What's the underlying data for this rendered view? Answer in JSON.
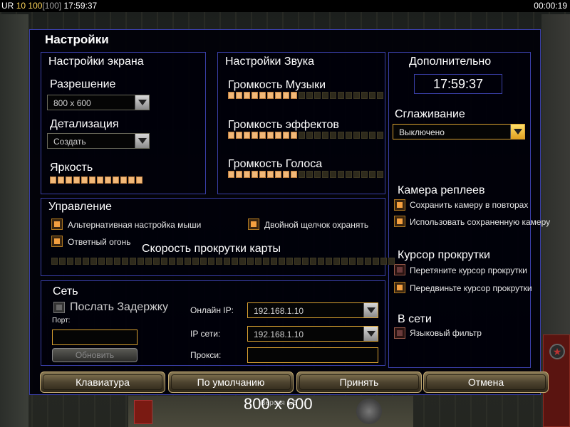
{
  "status_bar": {
    "ur": "UR",
    "level": "10",
    "power": "100",
    "power_max": "[100]",
    "clock": "17:59:37",
    "timer": "00:00:19"
  },
  "dialog": {
    "title": "Настройки",
    "screen": {
      "title": "Настройки экрана",
      "resolution_label": "Разрешение",
      "resolution_value": "800 x 600",
      "detail_label": "Детализация",
      "detail_value": "Создать",
      "brightness_label": "Яркость",
      "brightness_level": 12,
      "brightness_max": 12
    },
    "sound": {
      "title": "Настройки Звука",
      "music_label": "Громкость Музыки",
      "music_level": 9,
      "effects_label": "Громкость эффектов",
      "effects_level": 9,
      "voice_label": "Громкость Голоса",
      "voice_level": 9,
      "segments_max": 20
    },
    "extra": {
      "title": "Дополнительно",
      "clock": "17:59:37",
      "antialias_label": "Сглаживание",
      "antialias_value": "Выключено",
      "replay_camera_label": "Камера реплеев",
      "save_camera": "Сохранить камеру в повторах",
      "use_saved_camera": "Использовать сохраненную камеру",
      "scroll_cursor_label": "Курсор прокрутки",
      "drag_cursor": "Перетяните курсор прокрутки",
      "move_cursor": "Передвиньте курсор прокрутки",
      "online_label": "В сети",
      "language_filter": "Языковый фильтр"
    },
    "control": {
      "title": "Управление",
      "alt_mouse": "Альтернативная настройка мыши",
      "double_click_guard": "Двойной щелчок охранять",
      "return_fire": "Ответный огонь",
      "scroll_speed_label": "Скорость прокрутки карты",
      "scroll_speed_level": 0,
      "scroll_segments_max": 44
    },
    "network": {
      "title": "Сеть",
      "send_delay": "Послать Задержку",
      "port_label": "Порт:",
      "port_value": "",
      "online_ip_label": "Онлайн IP:",
      "online_ip_value": "192.168.1.10",
      "lan_ip_label": "IP сети:",
      "lan_ip_value": "192.168.1.10",
      "proxy_label": "Прокси:",
      "proxy_value": "",
      "refresh_button": "Обновить"
    },
    "buttons": {
      "keyboard": "Клавиатура",
      "defaults": "По умолчанию",
      "accept": "Принять",
      "cancel": "Отмена"
    },
    "footer_resolution": "800 x 600",
    "version": "Версия 1.6"
  },
  "colors": {
    "panel_border": "#3a3fa8",
    "slider_on": "#f2b878",
    "slider_off": "#2e2a1c",
    "accent_orange": "#d8a030"
  }
}
